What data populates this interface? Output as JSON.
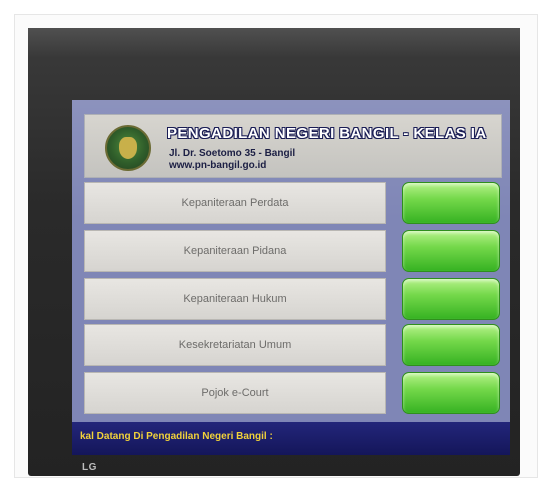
{
  "header": {
    "title": "PENGADILAN NEGERI BANGIL - KELAS IA",
    "address": "Jl. Dr. Soetomo 35 - Bangil",
    "website": "www.pn-bangil.go.id"
  },
  "menu": {
    "items": [
      {
        "label": "Kepaniteraan Perdata"
      },
      {
        "label": "Kepaniteraan Pidana"
      },
      {
        "label": "Kepaniteraan Hukum"
      },
      {
        "label": "Kesekretariatan Umum"
      },
      {
        "label": "Pojok e-Court"
      }
    ]
  },
  "footer": {
    "ticker": "kal Datang Di Pengadilan Negeri Bangil :"
  },
  "monitor": {
    "brand": "LG"
  },
  "colors": {
    "screen_background": "#7f86b6",
    "button_green": "#5cc93a",
    "footer_background": "#1c1f6e",
    "ticker_text": "#f1d23a"
  }
}
